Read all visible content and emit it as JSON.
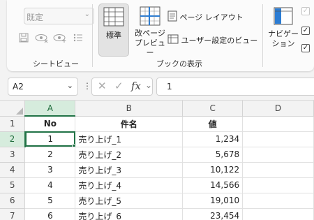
{
  "ribbon": {
    "sheet_view": {
      "combo_value": "既定",
      "group_label": "シートビュー"
    },
    "workbook_views": {
      "normal_label": "標準",
      "page_break_label_1": "改ページ",
      "page_break_label_2": "プレビュー",
      "page_layout_label": "ページ レイアウト",
      "custom_views_label": "ユーザー設定のビュー",
      "group_label": "ブックの表示"
    },
    "navigation": {
      "label_1": "ナビゲー",
      "label_2": "ション"
    },
    "checkboxes": [
      "✓",
      "✓",
      "✓"
    ]
  },
  "formula_bar": {
    "name_box": "A2",
    "separator": "⋮",
    "formula": "1"
  },
  "sheet": {
    "columns": [
      "A",
      "B",
      "C",
      "D"
    ],
    "rows": [
      {
        "n": "1",
        "a": "No",
        "b": "件名",
        "c": "値",
        "d": ""
      },
      {
        "n": "2",
        "a": "1",
        "b": "売り上げ_1",
        "c": "1,234",
        "d": ""
      },
      {
        "n": "3",
        "a": "2",
        "b": "売り上げ_2",
        "c": "5,678",
        "d": ""
      },
      {
        "n": "4",
        "a": "3",
        "b": "売り上げ_3",
        "c": "10,122",
        "d": ""
      },
      {
        "n": "5",
        "a": "4",
        "b": "売り上げ_4",
        "c": "14,566",
        "d": ""
      },
      {
        "n": "6",
        "a": "5",
        "b": "売り上げ_5",
        "c": "19,010",
        "d": ""
      },
      {
        "n": "7",
        "a": "6",
        "b": "売り上げ_6",
        "c": "23,454",
        "d": ""
      }
    ]
  },
  "colors": {
    "accent": "#217346",
    "selected_header": "#d6ecdd"
  }
}
